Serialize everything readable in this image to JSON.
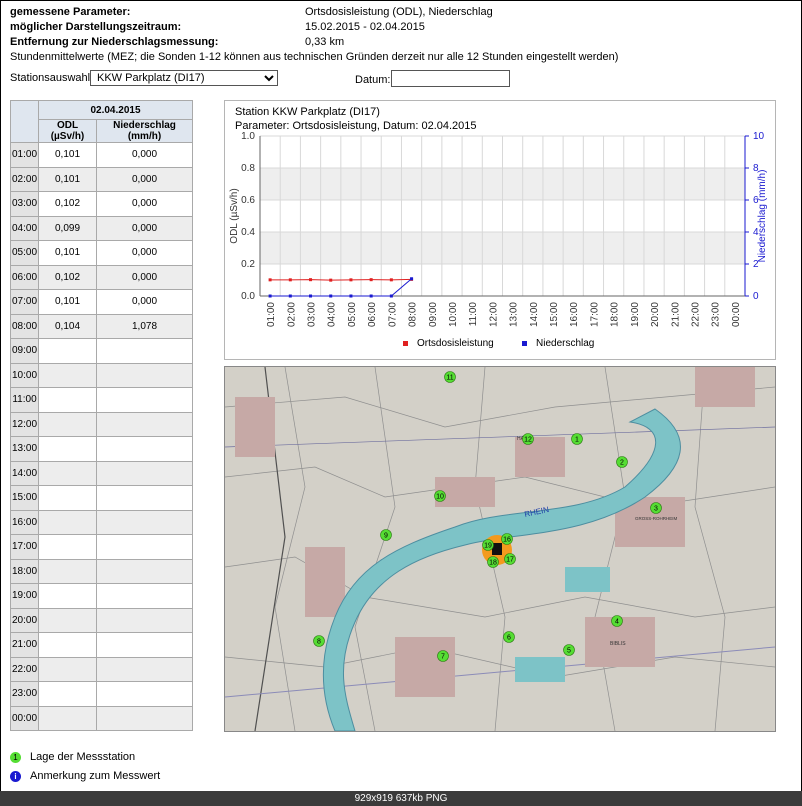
{
  "params": {
    "gemessene_label": "gemessene Parameter:",
    "gemessene_value": "Ortsdosisleistung (ODL), Niederschlag",
    "zeitraum_label": "möglicher Darstellungszeitraum:",
    "zeitraum_value": "15.02.2015 - 02.04.2015",
    "entfernung_label": "Entfernung zur Niederschlagsmessung:",
    "entfernung_value": "0,33 km",
    "note": "Stundenmittelwerte (MEZ; die Sonden 1-12 können aus technischen Gründen derzeit nur alle 12 Stunden eingestellt werden)"
  },
  "station": {
    "label": "Stationsauswahl:",
    "selected": "KKW Parkplatz (DI17)",
    "datum_label": "Datum:",
    "datum_value": ""
  },
  "table": {
    "date": "02.04.2015",
    "col_odl": "ODL (µSv/h)",
    "col_ns": "Niederschlag (mm/h)",
    "rows": [
      {
        "hour": "01:00",
        "odl": "0,101",
        "ns": "0,000"
      },
      {
        "hour": "02:00",
        "odl": "0,101",
        "ns": "0,000"
      },
      {
        "hour": "03:00",
        "odl": "0,102",
        "ns": "0,000"
      },
      {
        "hour": "04:00",
        "odl": "0,099",
        "ns": "0,000"
      },
      {
        "hour": "05:00",
        "odl": "0,101",
        "ns": "0,000"
      },
      {
        "hour": "06:00",
        "odl": "0,102",
        "ns": "0,000"
      },
      {
        "hour": "07:00",
        "odl": "0,101",
        "ns": "0,000"
      },
      {
        "hour": "08:00",
        "odl": "0,104",
        "ns": "1,078"
      },
      {
        "hour": "09:00",
        "odl": "",
        "ns": ""
      },
      {
        "hour": "10:00",
        "odl": "",
        "ns": ""
      },
      {
        "hour": "11:00",
        "odl": "",
        "ns": ""
      },
      {
        "hour": "12:00",
        "odl": "",
        "ns": ""
      },
      {
        "hour": "13:00",
        "odl": "",
        "ns": ""
      },
      {
        "hour": "14:00",
        "odl": "",
        "ns": ""
      },
      {
        "hour": "15:00",
        "odl": "",
        "ns": ""
      },
      {
        "hour": "16:00",
        "odl": "",
        "ns": ""
      },
      {
        "hour": "17:00",
        "odl": "",
        "ns": ""
      },
      {
        "hour": "18:00",
        "odl": "",
        "ns": ""
      },
      {
        "hour": "19:00",
        "odl": "",
        "ns": ""
      },
      {
        "hour": "20:00",
        "odl": "",
        "ns": ""
      },
      {
        "hour": "21:00",
        "odl": "",
        "ns": ""
      },
      {
        "hour": "22:00",
        "odl": "",
        "ns": ""
      },
      {
        "hour": "23:00",
        "odl": "",
        "ns": ""
      },
      {
        "hour": "00:00",
        "odl": "",
        "ns": ""
      }
    ]
  },
  "chart_data": {
    "type": "line",
    "title": "Station KKW Parkplatz (DI17)",
    "subtitle": "Parameter: Ortsdosisleistung, Datum: 02.04.2015",
    "ylabel": "ODL (µSv/h)",
    "y2label": "Niederschlag (mm/h)",
    "ylim": [
      0,
      1.0
    ],
    "y2lim": [
      0,
      10
    ],
    "yticks": [
      "0.0",
      "0.2",
      "0.4",
      "0.6",
      "0.8",
      "1.0"
    ],
    "y2ticks": [
      "0",
      "2",
      "4",
      "6",
      "8",
      "10"
    ],
    "categories": [
      "01:00",
      "02:00",
      "03:00",
      "04:00",
      "05:00",
      "06:00",
      "07:00",
      "08:00",
      "09:00",
      "10:00",
      "11:00",
      "12:00",
      "13:00",
      "14:00",
      "15:00",
      "16:00",
      "17:00",
      "18:00",
      "19:00",
      "20:00",
      "21:00",
      "22:00",
      "23:00",
      "00:00"
    ],
    "series": [
      {
        "name": "Ortsdosisleistung",
        "axis": "left",
        "color": "#e02020",
        "values": [
          0.101,
          0.101,
          0.102,
          0.099,
          0.101,
          0.102,
          0.101,
          0.104
        ]
      },
      {
        "name": "Niederschlag",
        "axis": "right",
        "color": "#1a1ad0",
        "values": [
          0.0,
          0.0,
          0.0,
          0.0,
          0.0,
          0.0,
          0.0,
          1.078
        ]
      }
    ],
    "grid": true,
    "legend": "bottom"
  },
  "map": {
    "stations": [
      {
        "id": "1"
      },
      {
        "id": "2"
      },
      {
        "id": "3"
      },
      {
        "id": "4"
      },
      {
        "id": "5"
      },
      {
        "id": "6"
      },
      {
        "id": "7"
      },
      {
        "id": "8"
      },
      {
        "id": "9"
      },
      {
        "id": "10"
      },
      {
        "id": "11"
      },
      {
        "id": "12"
      },
      {
        "id": "16"
      },
      {
        "id": "17"
      },
      {
        "id": "18"
      },
      {
        "id": "19"
      }
    ],
    "places": [
      "HAMM",
      "GROSS-ROHRHEIM",
      "BIBLIS",
      "RHEIN"
    ],
    "colors": {
      "station": "#55dd33",
      "reactor": "#f39a1e",
      "river": "#7dc3c7",
      "base": "#d3d0c8"
    }
  },
  "legend": {
    "station_icon_text": "1",
    "station_label": "Lage der Messstation",
    "note_icon_text": "i",
    "note_label": "Anmerkung zum Messwert"
  },
  "statusbar": "929x919  637kb  PNG"
}
